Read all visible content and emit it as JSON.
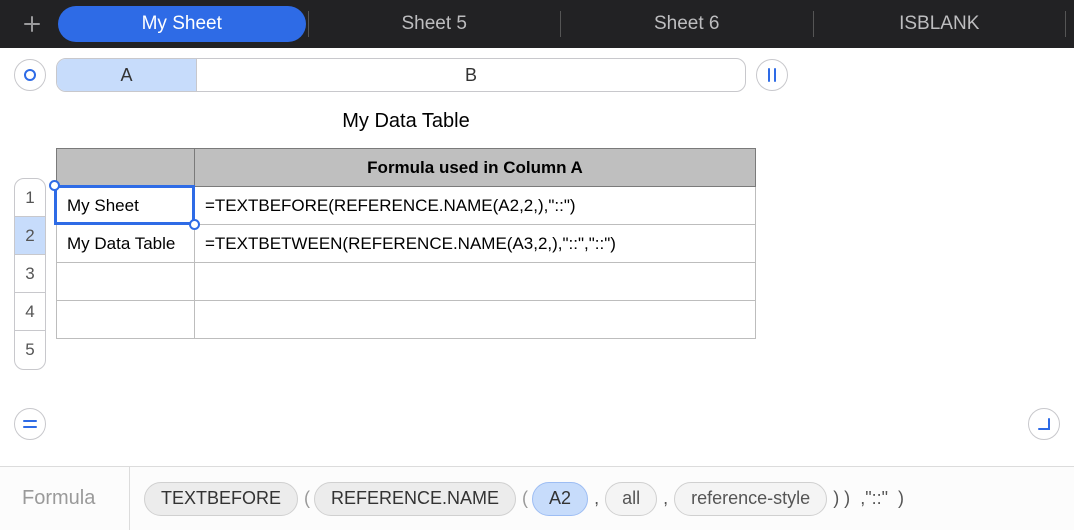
{
  "tabs": [
    {
      "label": "My Sheet",
      "active": true
    },
    {
      "label": "Sheet 5",
      "active": false
    },
    {
      "label": "Sheet 6",
      "active": false
    },
    {
      "label": "ISBLANK",
      "active": false
    }
  ],
  "columns": {
    "A": "A",
    "B": "B"
  },
  "rows": [
    "1",
    "2",
    "3",
    "4",
    "5"
  ],
  "active_row": "2",
  "active_col": "A",
  "table": {
    "title": "My Data Table",
    "header": "Formula used in Column A",
    "cells": {
      "A2": "My Sheet",
      "B2": "=TEXTBEFORE(REFERENCE.NAME(A2,2,),\"::\")",
      "A3": "My Data Table",
      "B3": "=TEXTBETWEEN(REFERENCE.NAME(A3,2,),\"::\",\"::\")",
      "A4": "",
      "B4": "",
      "A5": "",
      "B5": ""
    }
  },
  "formula_bar": {
    "label": "Formula",
    "tokens": {
      "fn1": "TEXTBEFORE",
      "fn2": "REFERENCE.NAME",
      "ref": "A2",
      "arg2": "all",
      "arg3": "reference-style",
      "tail": ",\"::\""
    }
  }
}
